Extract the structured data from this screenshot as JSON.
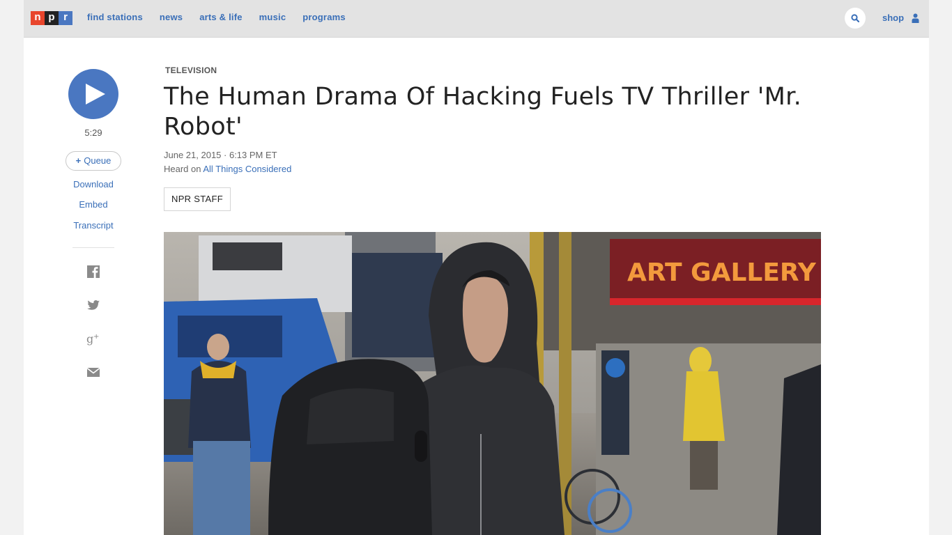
{
  "brand": {
    "letters": [
      "n",
      "p",
      "r"
    ],
    "colors": [
      "#e8452c",
      "#222222",
      "#4a77c1"
    ]
  },
  "nav": {
    "items": [
      "find stations",
      "news",
      "arts & life",
      "music",
      "programs"
    ],
    "shop_label": "shop",
    "search_icon": "search-icon",
    "user_icon": "user-icon"
  },
  "player": {
    "duration": "5:29",
    "queue_label": "Queue",
    "download_label": "Download",
    "embed_label": "Embed",
    "transcript_label": "Transcript"
  },
  "share": {
    "icons": [
      "facebook-icon",
      "twitter-icon",
      "google-plus-icon",
      "email-icon"
    ]
  },
  "article": {
    "section": "TELEVISION",
    "headline": "The Human Drama Of Hacking Fuels TV Thriller 'Mr. Robot'",
    "date": "June 21, 2015 · 6:13 PM ET",
    "heard_prefix": "Heard on ",
    "heard_program": "All Things Considered",
    "byline": "NPR STAFF"
  },
  "photo": {
    "sign_text": "ART GALLERY"
  },
  "colors": {
    "accent": "#3a6fb8",
    "play_button": "#4a77c1",
    "topbar": "#e3e3e3"
  }
}
